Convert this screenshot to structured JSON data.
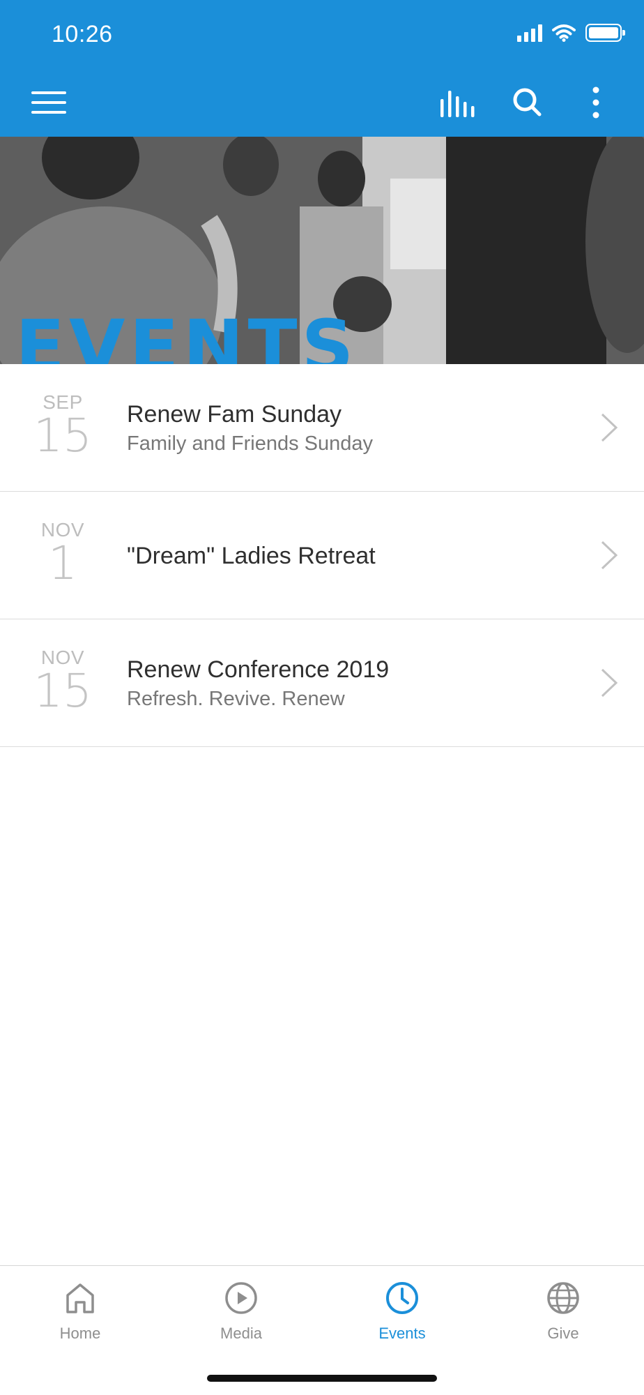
{
  "status_bar": {
    "time": "10:26"
  },
  "app_bar": {
    "color": "#1b8fd9",
    "icons": [
      "menu-icon",
      "audio-bars-icon",
      "search-icon",
      "more-vertical-icon"
    ]
  },
  "hero": {
    "text": "EVENTS"
  },
  "events": [
    {
      "month": "SEP",
      "day": "15",
      "title": "Renew Fam Sunday",
      "subtitle": "Family and Friends Sunday"
    },
    {
      "month": "NOV",
      "day": "1",
      "title": "\"Dream\" Ladies Retreat",
      "subtitle": ""
    },
    {
      "month": "NOV",
      "day": "15",
      "title": "Renew Conference 2019",
      "subtitle": "Refresh. Revive. Renew"
    }
  ],
  "tabs": [
    {
      "label": "Home",
      "icon": "home-icon",
      "active": false
    },
    {
      "label": "Media",
      "icon": "play-circle-icon",
      "active": false
    },
    {
      "label": "Events",
      "icon": "clock-icon",
      "active": true
    },
    {
      "label": "Give",
      "icon": "globe-icon",
      "active": false
    }
  ],
  "colors": {
    "accent": "#1b8fd9",
    "inactive_tab": "#8e8e8e"
  }
}
